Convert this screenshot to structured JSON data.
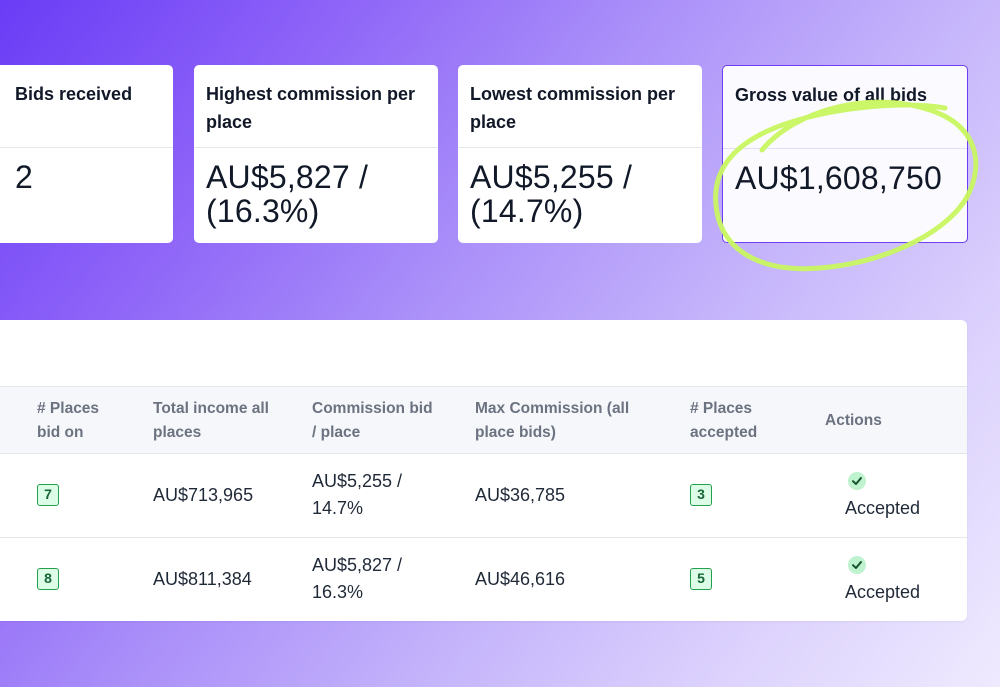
{
  "stats": {
    "bids_received": {
      "label": "Bids received",
      "value": "2"
    },
    "highest_commission": {
      "label_line1": "Highest commission per",
      "label_line2": "place",
      "value_line1": "AU$5,827 /",
      "value_line2": "(16.3%)"
    },
    "lowest_commission": {
      "label_line1": "Lowest commission per",
      "label_line2": "place",
      "value_line1": "AU$5,255 /",
      "value_line2": "(14.7%)"
    },
    "gross_value": {
      "label": "Gross value of all bids",
      "value": "AU$1,608,750"
    }
  },
  "annotation": {
    "color": "#c8f560",
    "icon": "hand-drawn-circle"
  },
  "table": {
    "columns": [
      {
        "line1": "# Places",
        "line2": "bid on"
      },
      {
        "line1": "Total income all",
        "line2": "places"
      },
      {
        "line1": "Commission bid",
        "line2": "/ place"
      },
      {
        "line1": "Max Commission (all",
        "line2": "place bids)"
      },
      {
        "line1": "# Places",
        "line2": "accepted"
      },
      {
        "line1": "Actions",
        "line2": ""
      }
    ],
    "rows": [
      {
        "places_bid_on": "7",
        "total_income": "AU$713,965",
        "commission_line1": "AU$5,255 /",
        "commission_line2": "14.7%",
        "max_commission": "AU$36,785",
        "places_accepted": "3",
        "action": "Accepted"
      },
      {
        "places_bid_on": "8",
        "total_income": "AU$811,384",
        "commission_line1": "AU$5,827 /",
        "commission_line2": "16.3%",
        "max_commission": "AU$46,616",
        "places_accepted": "5",
        "action": "Accepted"
      }
    ]
  },
  "colors": {
    "accent": "#6d3ff0",
    "badge_green": "#22a04b",
    "badge_bg": "#dcfce7"
  }
}
